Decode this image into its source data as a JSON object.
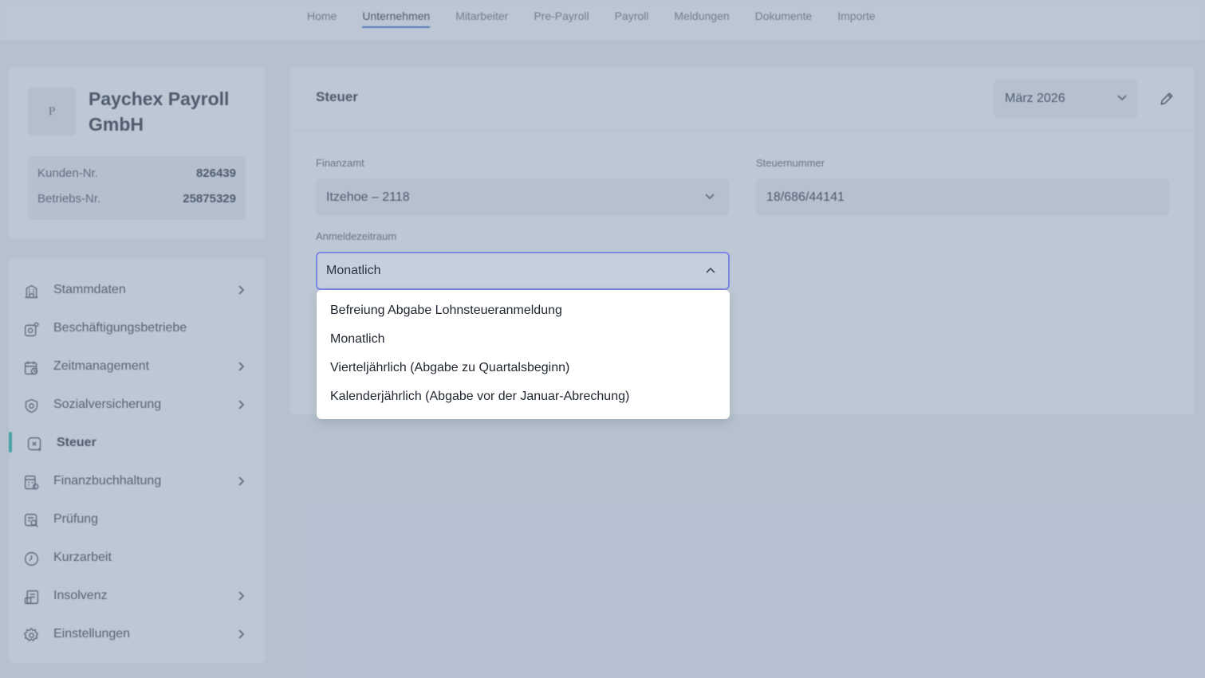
{
  "topnav": {
    "tabs": [
      {
        "label": "Home"
      },
      {
        "label": "Unternehmen"
      },
      {
        "label": "Mitarbeiter"
      },
      {
        "label": "Pre-Payroll"
      },
      {
        "label": "Payroll"
      },
      {
        "label": "Meldungen"
      },
      {
        "label": "Dokumente"
      },
      {
        "label": "Importe"
      }
    ],
    "active": "Unternehmen"
  },
  "company": {
    "logo_letter": "P",
    "name": "Paychex Payroll GmbH",
    "customer_no_label": "Kunden-Nr.",
    "customer_no": "826439",
    "betriebs_no_label": "Betriebs-Nr.",
    "betriebs_no": "25875329"
  },
  "sidebar": {
    "items": [
      {
        "label": "Stammdaten",
        "icon": "building-icon",
        "has_chevron": true
      },
      {
        "label": "Beschäftigungsbetriebe",
        "icon": "workplace-icon",
        "has_chevron": false
      },
      {
        "label": "Zeitmanagement",
        "icon": "calendar-clock-icon",
        "has_chevron": true
      },
      {
        "label": "Sozialversicherung",
        "icon": "shield-icon",
        "has_chevron": true
      },
      {
        "label": "Steuer",
        "icon": "tax-icon",
        "has_chevron": false,
        "active": true
      },
      {
        "label": "Finanzbuchhaltung",
        "icon": "ledger-icon",
        "has_chevron": true
      },
      {
        "label": "Prüfung",
        "icon": "audit-search-icon",
        "has_chevron": false
      },
      {
        "label": "Kurzarbeit",
        "icon": "clock-icon",
        "has_chevron": false
      },
      {
        "label": "Insolvenz",
        "icon": "document-money-icon",
        "has_chevron": true
      },
      {
        "label": "Einstellungen",
        "icon": "gear-icon",
        "has_chevron": true
      }
    ]
  },
  "main": {
    "title": "Steuer",
    "period": "März 2026",
    "finanzamt_label": "Finanzamt",
    "finanzamt_value": "Itzehoe – 2118",
    "steuernummer_label": "Steuernummer",
    "steuernummer_value": "18/686/44141",
    "anmeldezeitraum_label": "Anmeldezeitraum",
    "anmeldezeitraum_value": "Monatlich"
  },
  "dropdown": {
    "options": [
      "Befreiung Abgabe Lohnsteueranmeldung",
      "Monatlich",
      "Vierteljährlich (Abgabe zu Quartalsbeginn)",
      "Kalenderjährlich (Abgabe vor der Januar-Abrechung)"
    ]
  },
  "colors": {
    "accent": "#3a6fd8",
    "active_bar": "#1fb7a6",
    "focus_border": "#6a7be8"
  }
}
